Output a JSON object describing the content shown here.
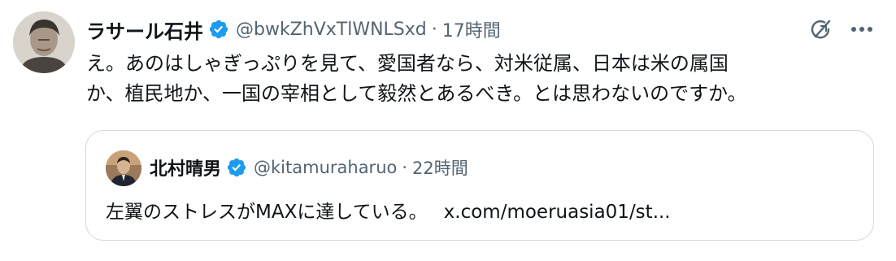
{
  "tweet": {
    "author_name": "ラサール石井",
    "author_handle": "@bwkZhVxTlWNLSxd",
    "separator": "·",
    "time": "17時間",
    "text_lines": [
      "え。あのはしゃぎっぷりを見て、愛国者なら、対米従属、日本は米の属国",
      "か、植民地か、一国の宰相として毅然とあるべき。とは思わないのですか。"
    ],
    "icons": {
      "verified": "verified-badge-icon",
      "grok": "grok-icon",
      "more": "more-options-icon"
    }
  },
  "quote": {
    "author_name": "北村晴男",
    "author_handle": "@kitamuraharuo",
    "separator": "·",
    "time": "22時間",
    "text": "左翼のストレスがMAXに達している。",
    "link": "x.com/moeruasia01/st..."
  },
  "colors": {
    "verified_blue": "#1d9bf0",
    "secondary_text": "#536471",
    "primary_text": "#0f1419",
    "border": "#cfd9de"
  }
}
